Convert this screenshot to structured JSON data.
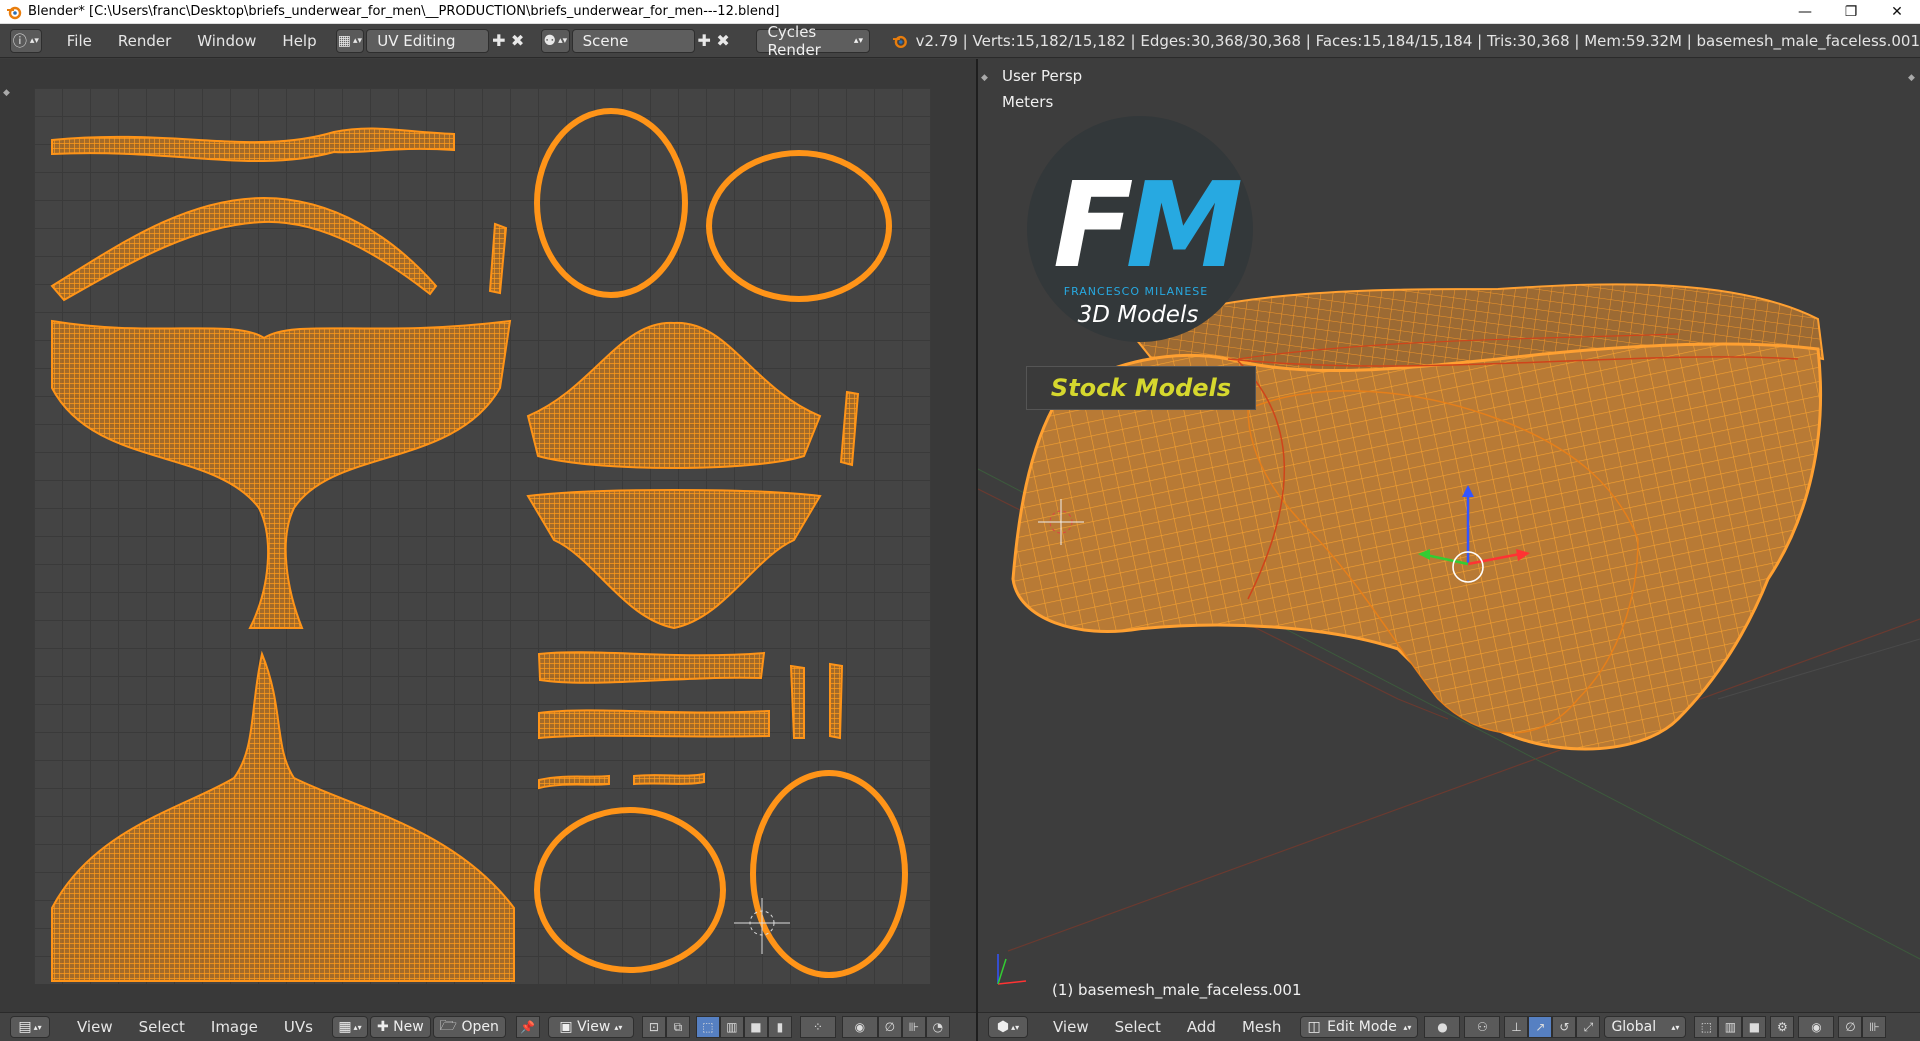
{
  "titlebar": {
    "title": "Blender* [C:\\Users\\franc\\Desktop\\briefs_underwear_for_men\\__PRODUCTION\\briefs_underwear_for_men---12.blend]",
    "minimize": "—",
    "restore": "❐",
    "close": "✕"
  },
  "infobar": {
    "editor_icon": "ⓘ",
    "menus": [
      "File",
      "Render",
      "Window",
      "Help"
    ],
    "screen_layout": "UV Editing",
    "scene": "Scene",
    "render_engine": "Cycles Render",
    "stats": "v2.79 | Verts:15,182/15,182 | Edges:30,368/30,368 | Faces:15,184/15,184 | Tris:30,368 | Mem:59.32M | basemesh_male_faceless.001"
  },
  "viewport": {
    "view_name": "User Persp",
    "units": "Meters",
    "object_label": "(1) basemesh_male_faceless.001",
    "logo": {
      "initial_f": "F",
      "initial_m": "M",
      "name": "FRANCESCO MILANESE",
      "subtitle": "3D Models",
      "badge": "Stock Models"
    }
  },
  "uv_header": {
    "menus": [
      "View",
      "Select",
      "Image",
      "UVs"
    ],
    "new_label": "New",
    "open_label": "Open",
    "view_label": "View"
  },
  "view3d_header": {
    "menus": [
      "View",
      "Select",
      "Add",
      "Mesh"
    ],
    "mode": "Edit Mode",
    "orientation": "Global"
  },
  "colors": {
    "uv_wire": "#f08a14",
    "mesh_fill": "#b87a35",
    "accent_blue": "#27a9e1",
    "badge_yellow": "#d6d82e"
  }
}
